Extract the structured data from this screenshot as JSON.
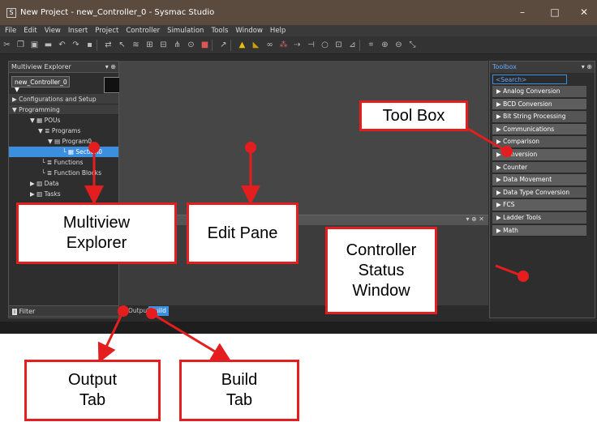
{
  "window": {
    "title": "New Project - new_Controller_0 - Sysmac Studio",
    "minimize": "–",
    "maximize": "□",
    "close": "✕"
  },
  "menu": [
    "File",
    "Edit",
    "View",
    "Insert",
    "Project",
    "Controller",
    "Simulation",
    "Tools",
    "Window",
    "Help"
  ],
  "multiview": {
    "header": "Multiview Explorer",
    "header_pin": "▾ ⊕",
    "controller": "new_Controller_0",
    "controller_arrow": "▼",
    "tree": [
      {
        "text": "▶ Configurations and Setup"
      },
      {
        "text": "▼ Programming"
      },
      {
        "text": "▼ ▦ POUs"
      },
      {
        "text": "▼ ≣ Programs"
      },
      {
        "text": "▼ ▤ Program0"
      },
      {
        "text": "└ ▦ Section0"
      },
      {
        "text": "└ ≣ Functions"
      },
      {
        "text": "└ ≣ Function Blocks"
      },
      {
        "text": "▶ ▥ Data"
      },
      {
        "text": "▶ ▥ Tasks"
      }
    ],
    "filter": "Filter",
    "filter_icon": "i"
  },
  "toolbox": {
    "header": "Toolbox",
    "header_pin": "▾ ⊕",
    "search_placeholder": "<Search>",
    "items": [
      "Analog Conversion",
      "BCD Conversion",
      "Bit String Processing",
      "Communications",
      "Comparison",
      "Conversion",
      "Counter",
      "Data Movement",
      "Data Type Conversion",
      "FCS",
      "Ladder Tools",
      "Math"
    ]
  },
  "csw": {
    "controls": "▾ ⊕ ✕"
  },
  "tabs": {
    "output": "Output",
    "build": "Build"
  },
  "annotations": {
    "toolbox": "Tool Box",
    "multiview": "Multiview Explorer",
    "edit": "Edit Pane",
    "csw": "Controller Status Window",
    "output": "Output Tab",
    "build": "Build Tab"
  },
  "colors": {
    "accent": "#e41e1e",
    "selection": "#3b8fde"
  }
}
